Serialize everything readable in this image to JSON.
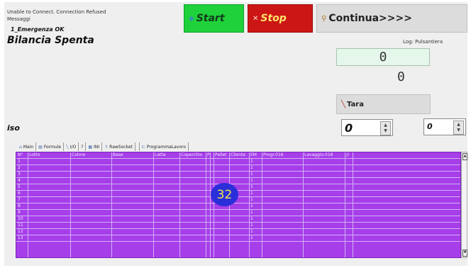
{
  "status": {
    "connection": "Unable to Connect. Connection Refused",
    "messages": "Messaggi",
    "emergency": "1_Emergenza OK",
    "main_title": "Bilancia Spenta"
  },
  "toolbar": {
    "start_label": "Start",
    "stop_label": "Stop",
    "continue_label": "Continua>>>>"
  },
  "right_panel": {
    "log_label": "Log: Pulsantiera",
    "weight_value": "0",
    "weight_value2": "0",
    "tara_label": "Tara"
  },
  "iso": {
    "label": "iso",
    "spin1_value": "0",
    "spin2_value": "0"
  },
  "tabs": [
    {
      "label": "Main",
      "icon": "home-icon"
    },
    {
      "label": "Formule",
      "icon": "doc-icon"
    },
    {
      "label": "I/O",
      "icon": "wrench-icon"
    },
    {
      "label": "?",
      "icon": ""
    },
    {
      "label": "INI",
      "icon": "ini-icon"
    },
    {
      "label": "RawSocket",
      "icon": "socket-icon"
    },
    {
      "label": "ProgrammaLavoro",
      "icon": "program-icon"
    }
  ],
  "table": {
    "columns": [
      "N°",
      "Lotto",
      "Colore",
      "Base",
      "Latta",
      "Coperchio",
      "P",
      "Pallet",
      "Cliente",
      "EM",
      "Progr.016",
      "Lavaggio.016",
      "//"
    ],
    "rows": [
      "1",
      "2",
      "3",
      "4",
      "5",
      "6",
      "7",
      "8",
      "9",
      "10",
      "11",
      "12",
      "13"
    ],
    "em_value": "1",
    "count_badge": "32"
  },
  "colors": {
    "start_bg": "#1fd13a",
    "stop_bg": "#cc1616",
    "table_bg": "#a63ee9",
    "badge_bg": "#2a2fd9",
    "badge_fg": "#f2e64a"
  }
}
